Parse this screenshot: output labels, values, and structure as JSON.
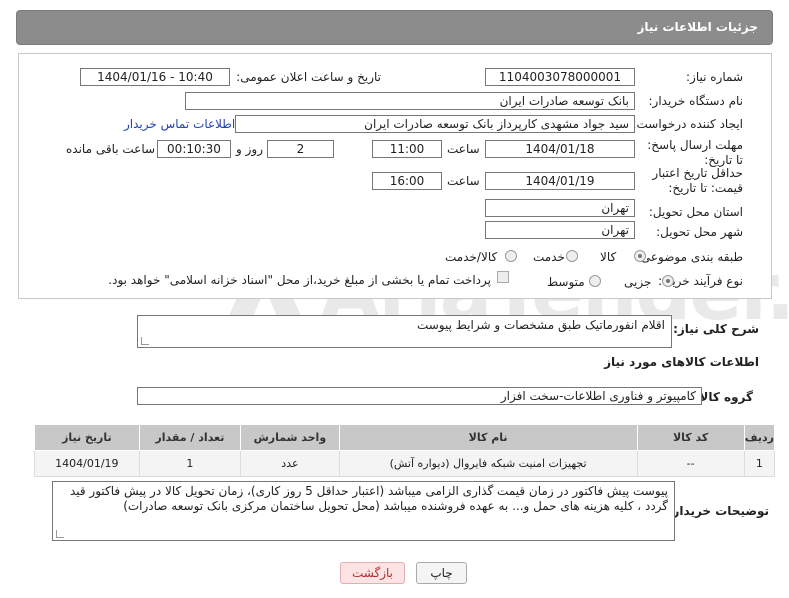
{
  "header": {
    "title": "جزئیات اطلاعات نیاز"
  },
  "watermark": {
    "text": "AriaTender.neT"
  },
  "form": {
    "need_number_label": "شماره نیاز:",
    "need_number": "1104003078000001",
    "announce_label": "تاریخ و ساعت اعلان عمومی:",
    "announce_value": "1404/01/16 - 10:40",
    "buyer_label": "نام دستگاه خریدار:",
    "buyer_value": "بانک توسعه صادرات ایران",
    "creator_label": "ایجاد کننده درخواست:",
    "creator_value": "سید جواد مشهدی کارپرداز بانک توسعه صادرات ایران",
    "contact_link": "اطلاعات تماس خریدار",
    "deadline_label": "مهلت ارسال پاسخ: تا تاریخ:",
    "deadline_date": "1404/01/18",
    "time_label": "ساعت",
    "deadline_time": "11:00",
    "days_value": "2",
    "days_label": "روز و",
    "remaining_value": "00:10:30",
    "remaining_label": "ساعت باقی مانده",
    "validity_label": "حداقل تاریخ اعتبار قیمت: تا تاریخ:",
    "validity_date": "1404/01/19",
    "validity_time": "16:00",
    "province_label": "استان محل تحویل:",
    "province_value": "تهران",
    "city_label": "شهر محل تحویل:",
    "city_value": "تهران",
    "category_label": "طبقه بندی موضوعی:",
    "category_options": [
      "کالا",
      "خدمت",
      "کالا/خدمت"
    ],
    "category_selected": "کالا",
    "process_label": "نوع فرآیند خرید :",
    "process_options": [
      "جزیی",
      "متوسط"
    ],
    "process_selected": "جزیی",
    "payment_note": "پرداخت تمام یا بخشی از مبلغ خرید،از محل \"اسناد خزانه اسلامی\" خواهد بود."
  },
  "description": {
    "label": "شرح کلی نیاز:",
    "value": "اقلام انفورماتیک طبق مشخصات و شرایط پیوست"
  },
  "goods": {
    "section_title": "اطلاعات کالاهای مورد نیاز",
    "group_label": "گروه کالا:",
    "group_value": "کامپیوتر و فناوری اطلاعات-سخت افزار",
    "columns": [
      "ردیف",
      "کد کالا",
      "نام کالا",
      "واحد شمارش",
      "تعداد / مقدار",
      "تاریخ نیاز"
    ],
    "rows": [
      [
        "1",
        "--",
        "تجهیزات امنیت شبکه فایروال (دیواره آتش)",
        "عدد",
        "1",
        "1404/01/19"
      ]
    ]
  },
  "buyer_notes": {
    "label": "توضیحات خریدار:",
    "value": "پیوست پیش فاکتور در زمان قیمت گذاری الزامی میباشد (اعتبار حداقل 5 روز کاری)، زمان تحویل کالا در پیش فاکتور قید گردد ، کلیه هزینه های حمل و... به عهده فروشنده میباشد (محل تحویل ساختمان مرکزی بانک توسعه صادرات)"
  },
  "buttons": {
    "print": "چاپ",
    "back": "بازگشت"
  }
}
